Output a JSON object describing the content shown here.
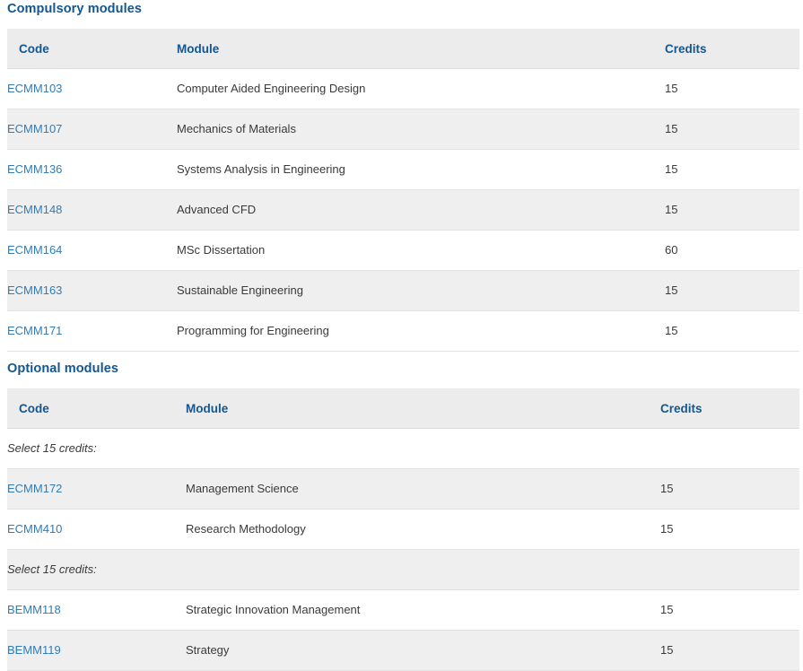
{
  "sections": [
    {
      "id": "compulsory",
      "heading": "Compulsory modules",
      "columns": {
        "code": "Code",
        "module": "Module",
        "credits": "Credits"
      },
      "rows": [
        {
          "type": "module",
          "code": "ECMM103",
          "module": "Computer Aided Engineering Design",
          "credits": "15"
        },
        {
          "type": "module",
          "code": "ECMM107",
          "module": "Mechanics of Materials",
          "credits": "15"
        },
        {
          "type": "module",
          "code": "ECMM136",
          "module": "Systems Analysis in Engineering",
          "credits": "15"
        },
        {
          "type": "module",
          "code": "ECMM148",
          "module": "Advanced CFD",
          "credits": "15"
        },
        {
          "type": "module",
          "code": "ECMM164",
          "module": "MSc Dissertation",
          "credits": "60"
        },
        {
          "type": "module",
          "code": "ECMM163",
          "module": "Sustainable Engineering",
          "credits": "15"
        },
        {
          "type": "module",
          "code": "ECMM171",
          "module": "Programming for Engineering",
          "credits": "15"
        }
      ]
    },
    {
      "id": "optional",
      "heading": "Optional modules",
      "columns": {
        "code": "Code",
        "module": "Module",
        "credits": "Credits"
      },
      "rows": [
        {
          "type": "note",
          "note": "Select 15 credits:"
        },
        {
          "type": "module",
          "code": "ECMM172",
          "module": "Management Science",
          "credits": "15"
        },
        {
          "type": "module",
          "code": "ECMM410",
          "module": "Research Methodology",
          "credits": "15"
        },
        {
          "type": "note",
          "note": "Select 15 credits:"
        },
        {
          "type": "module",
          "code": "BEMM118",
          "module": "Strategic Innovation Management",
          "credits": "15"
        },
        {
          "type": "module",
          "code": "BEMM119",
          "module": "Strategy",
          "credits": "15"
        }
      ]
    }
  ],
  "colors": {
    "heading": "#14568f",
    "link": "#2f7cb8",
    "header_bg": "#ececec",
    "stripe_bg": "#efefef",
    "text": "#3a3a3a"
  }
}
